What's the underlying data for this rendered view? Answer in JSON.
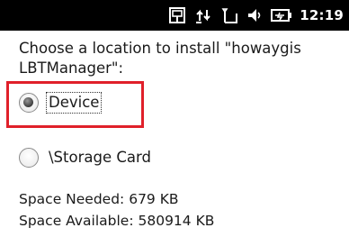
{
  "status_bar": {
    "icons": [
      "data-sync-icon",
      "network-transfer-icon",
      "signal-icon",
      "volume-icon",
      "battery-icon"
    ],
    "time": "12:19",
    "background": "#000000"
  },
  "dialog": {
    "prompt": "Choose a location to install \"howaygis LBTManager\":",
    "options": [
      {
        "label": "Device",
        "selected": true
      },
      {
        "label": "\\Storage Card",
        "selected": false
      }
    ],
    "space_needed_label": "Space Needed:",
    "space_needed_value": "679 KB",
    "space_available_label": "Space Available:",
    "space_available_value": "580914 KB"
  },
  "colors": {
    "highlight": "#e0202a",
    "text": "#1a1a1a"
  }
}
